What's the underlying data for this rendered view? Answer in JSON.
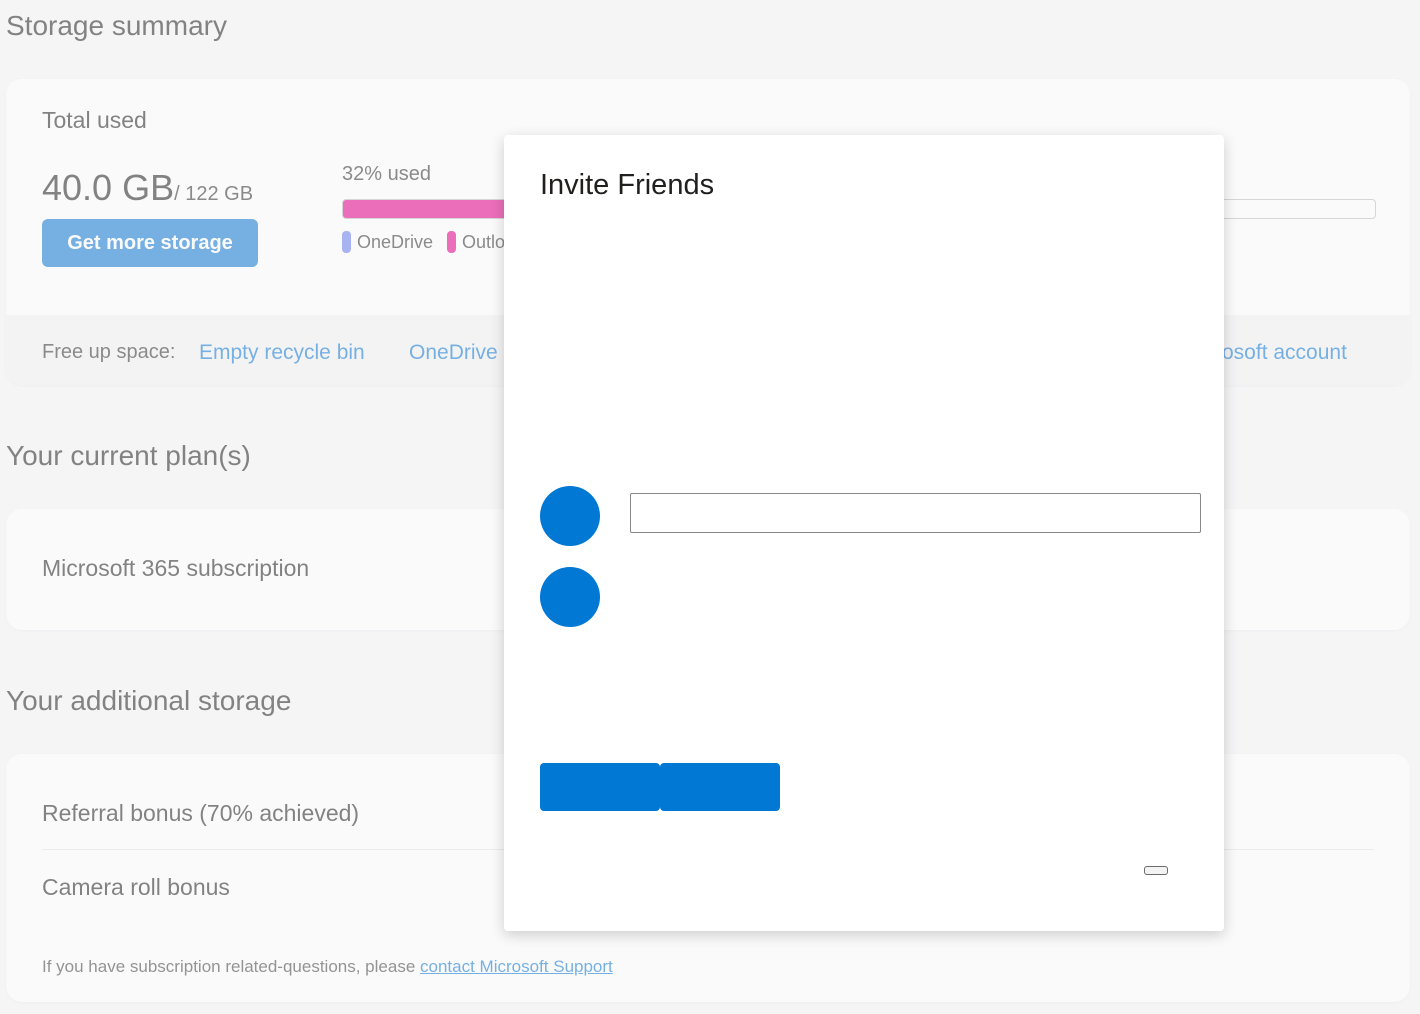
{
  "storage_summary": {
    "title": "Storage summary",
    "total_label": "Total used",
    "total_value": "40.0 GB",
    "total_capacity": "/ 122 GB",
    "get_more_label": "Get more storage",
    "used_label": "32% used",
    "used_fraction": 0.32,
    "legend": [
      {
        "label": "OneDrive",
        "color": "#6b7ff0"
      },
      {
        "label": "Outlo",
        "color": "#e3008c"
      }
    ],
    "free_up_label": "Free up space:",
    "free_up_links": [
      "Empty recycle bin",
      "OneDrive",
      "osoft account"
    ]
  },
  "current_plan": {
    "title": "Your current plan(s)",
    "plan_name": "Microsoft 365 subscription"
  },
  "additional_storage": {
    "title": "Your additional storage",
    "items": [
      "Referral bonus (70% achieved)",
      "Camera roll bonus"
    ],
    "footnote_prefix": "If you have subscription related-questions, please ",
    "footnote_link": "contact Microsoft Support"
  },
  "modal": {
    "title": "Invite Friends",
    "input_value": "",
    "accent": "#0078d4"
  }
}
